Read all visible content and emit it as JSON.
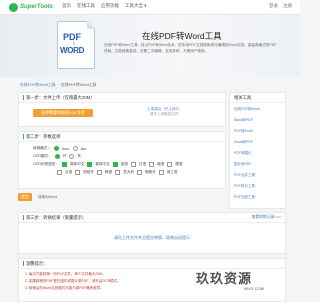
{
  "nav": {
    "logo": "SuperTools",
    "links": [
      "首页",
      "在线工具",
      "应用功能",
      "工具大全 ▾"
    ],
    "right": [
      "登录",
      "注册"
    ]
  },
  "hero": {
    "graphic_top": "PDF",
    "graphic_bottom": "WORD",
    "graphic_arrow": "⇩",
    "title": "在线PDF转Word工具",
    "desc": "在线PDF转Word工具 - 将以PDF转Word技术，把本地PDF文档转换成可编辑的Word文档，保留原格式的PDF排版、文档转换高效、无需二次编辑、支持多种、方便用户使用。"
  },
  "breadcrumb": {
    "home": "在线PDF转Word工具",
    "current": "在线PDF转Word工具"
  },
  "step1": {
    "title": "第一步：文件上传（仅限最大20M）",
    "upload_button": "选择需要转换的PDF文件",
    "hint_line1": "上传成功（已上传0）",
    "hint_line2": "请勿上传敏感文件"
  },
  "step2": {
    "title": "第二步：参数选择",
    "row1_label": "转换格式：",
    "row1_options": [
      "docx",
      "doc"
    ],
    "row2_label": "OCR模式：",
    "row2_options": [
      "开",
      "关"
    ],
    "row3_label": "OCR识别语言：",
    "row3_options": [
      "简体中文",
      "繁体中文",
      "英语",
      "日语",
      "俄语",
      "德语",
      "法语"
    ],
    "row4_options": [
      "法语",
      "西班牙",
      "韩语",
      "意大利",
      "葡萄牙",
      "荷兰语"
    ]
  },
  "submit": {
    "button": "提交",
    "label": "转换为Word"
  },
  "step3": {
    "title": "第三步：转换结果（限量提示）",
    "history": "查看转换记录>>>",
    "result": "请先上传文件并且提交转换，结果自动提示"
  },
  "tips": {
    "title": "温馨提示：",
    "lines": [
      "1. 每次只能转换一份PDF文件，单个文件最大20M。",
      "2. 如果转换的PDF是扫描件或图片型PDF，请开启OCR模式。",
      "3. 转换后的Word文档格式可能与原PDF略有差异。"
    ]
  },
  "sidebar": {
    "title": "相关工具",
    "links": [
      "在线PDF转Word",
      "Word转PDF",
      "PDF转Excel",
      "Excel转PDF",
      "PDF转图片",
      "图片转PDF",
      "PDF合并工具",
      "PDF拆分工具",
      "PDF加密工具"
    ]
  },
  "watermark": {
    "title": "玖玖资源",
    "sub": "99YZ.COM"
  }
}
